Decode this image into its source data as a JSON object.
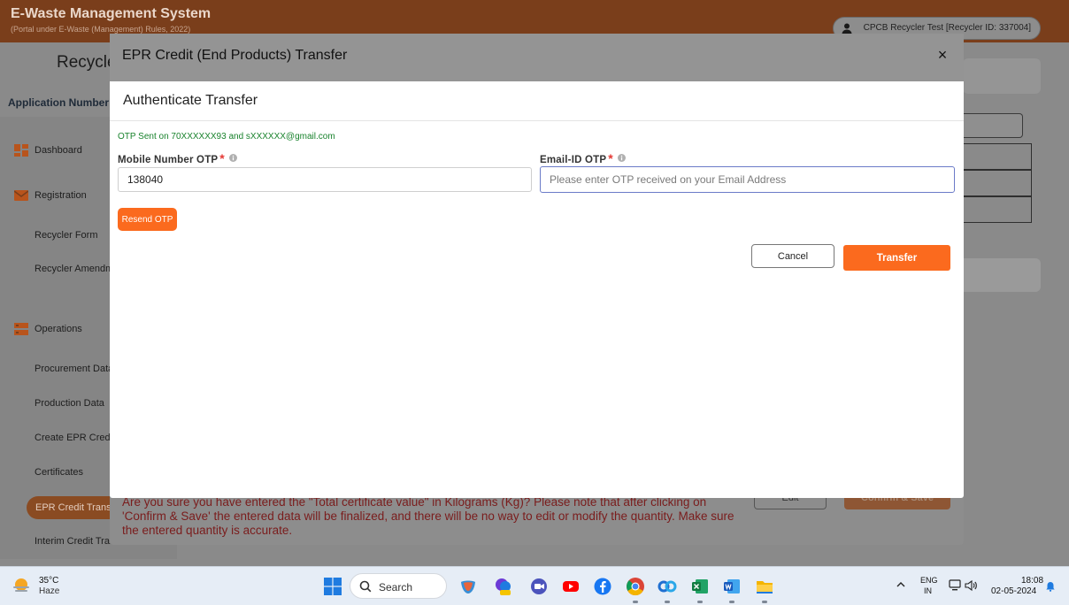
{
  "app": {
    "title": "E-Waste Management System",
    "subtitle": "(Portal under E-Waste (Management) Rules, 2022)",
    "user": "CPCB Recycler Test [Recycler ID: 337004]",
    "heading": "Recycler",
    "application_number": "Application Number"
  },
  "sidebar": {
    "items": [
      {
        "label": "Dashboard",
        "icon": "dashboard-icon"
      },
      {
        "label": "Registration",
        "icon": "mail-icon"
      },
      {
        "label": "Recycler Form"
      },
      {
        "label": "Recycler Amendment"
      },
      {
        "label": "Operations",
        "icon": "server-icon"
      },
      {
        "label": "Procurement Data"
      },
      {
        "label": "Production Data"
      },
      {
        "label": "Create EPR Credit"
      },
      {
        "label": "Certificates"
      },
      {
        "label": "EPR Credit Transfer"
      },
      {
        "label": "Interim Credit Transactions"
      }
    ]
  },
  "background": {
    "warning": "Are you sure you have entered the \"Total certificate value\" in Kilograms (Kg)? Please note that after clicking on 'Confirm & Save' the entered data will be finalized, and there will be no way to edit or modify the quantity. Make sure the entered quantity is accurate.",
    "edit_label": "Edit",
    "confirm_label": "Confirm & Save"
  },
  "outer_modal": {
    "title": "EPR Credit (End Products) Transfer",
    "close_symbol": "×"
  },
  "dialog": {
    "title": "Authenticate Transfer",
    "otp_sent": "OTP Sent on 70XXXXXX93 and sXXXXXX@gmail.com",
    "mobile_label": "Mobile Number OTP",
    "mobile_value": "138040",
    "email_label": "Email-ID OTP",
    "email_placeholder": "Please enter OTP received on your Email Address",
    "required_mark": "*",
    "resend_label": "Resend OTP",
    "cancel_label": "Cancel",
    "transfer_label": "Transfer"
  },
  "taskbar": {
    "temperature": "35°C",
    "weather": "Haze",
    "search_label": "Search",
    "lang_top": "ENG",
    "lang_bottom": "IN",
    "time": "18:08",
    "date": "02-05-2024",
    "apps": [
      "copilot-icon",
      "pre-app-icon",
      "meet-icon",
      "youtube-icon",
      "facebook-icon",
      "chrome-icon",
      "capcut-icon",
      "excel-icon",
      "word-icon",
      "file-explorer-icon"
    ]
  },
  "colors": {
    "accent": "#fb6a1e",
    "success_text": "#18822c",
    "required": "#e53935",
    "focus_border": "#6b7bc8"
  }
}
